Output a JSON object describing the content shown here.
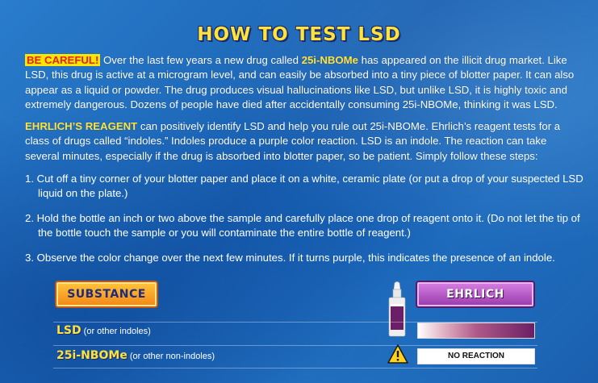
{
  "title": "HOW TO TEST LSD",
  "careful": {
    "badge": "BE CAREFUL!",
    "text_before_drug": " Over the last few years a new drug called ",
    "drug": "25i-NBOMe",
    "text_after_drug": " has appeared on the illicit drug market. Like LSD, this drug is active at a microgram level, and can easily be absorbed into a tiny piece of blotter paper. It can also appear as a liquid or powder. The drug produces visual hallucinations like LSD, but unlike LSD, it is highly toxic and extremely dangerous. Dozens of people have died after accidentally consuming 25i-NBOMe, thinking it was LSD."
  },
  "ehrlich": {
    "label": "EHRLICH’S REAGENT",
    "text": " can positively identify LSD and help you rule out 25i-NBOMe. Ehrlich’s reagent tests for a class of drugs called “indoles.” Indoles produce a purple color reaction. LSD is an indole. The reaction can take several minutes, especially if the drug is absorbed into blotter paper, so be patient. Simply follow these steps:"
  },
  "steps": [
    "1. Cut off a tiny corner of your blotter paper and place it on a white, ceramic plate (or put a drop of your suspected LSD liquid on the plate.)",
    "2. Hold the bottle an inch or two above the sample and carefully place one drop of reagent onto it. (Do not let the tip of the bottle touch the sample or you will contaminate the entire bottle of reagent.)",
    "3. Observe the color change over the next few minutes. If it turns purple, this indicates the presence of an indole."
  ],
  "table": {
    "substance_header": "SUBSTANCE",
    "reagent_header": "EHRLICH",
    "rows": [
      {
        "name": "LSD",
        "note": " (or other indoles)",
        "result": "",
        "result_color": "#6a1e64"
      },
      {
        "name": "25i-NBOMe",
        "note": " (or other non-indoles)",
        "result": "NO REACTION",
        "result_color": "#ffffff"
      }
    ]
  },
  "colors": {
    "background": "#1f6fc0",
    "title": "#ffe23a",
    "careful_bg": "#ffe600",
    "careful_text": "#e3201b",
    "substance_badge": "#f28a1a",
    "ehrlich_badge": "#9b3fae"
  },
  "icons": [
    "reagent-bottle-icon",
    "warning-triangle-icon"
  ]
}
